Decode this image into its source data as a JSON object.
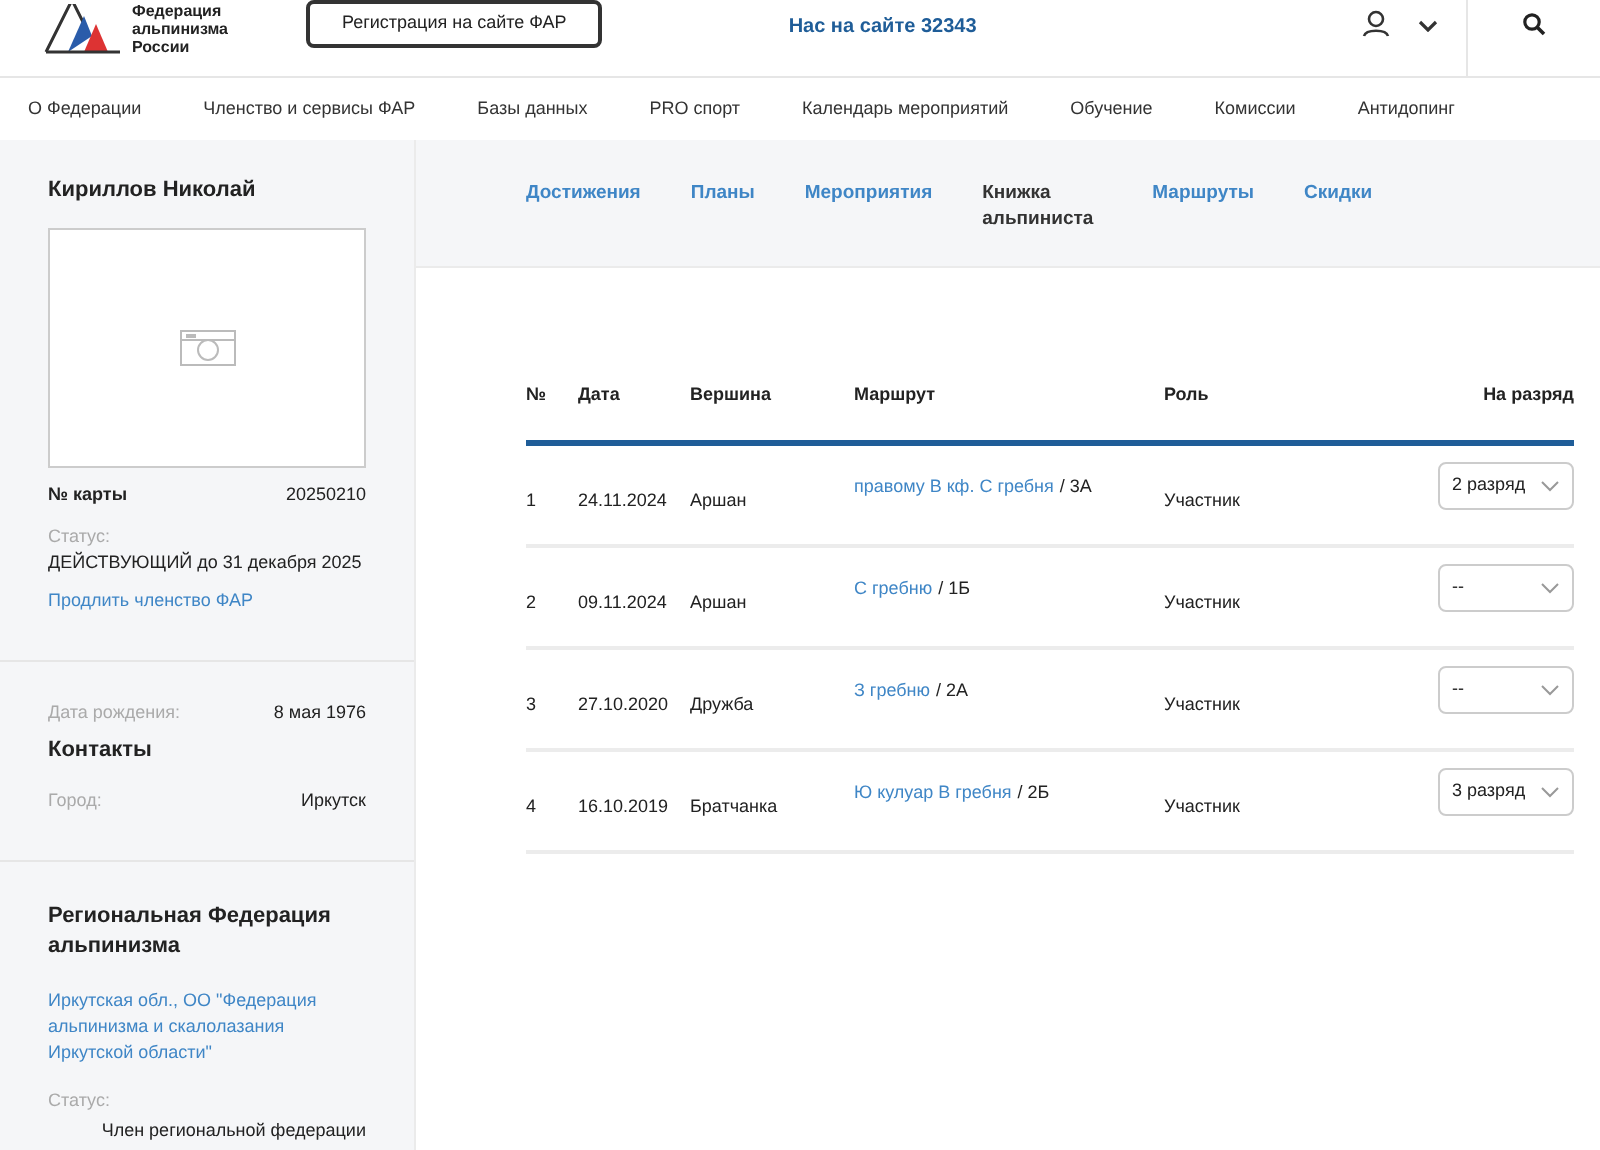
{
  "header": {
    "logo_text": "Федерация альпинизма России",
    "register_button": "Регистрация на сайте ФАР",
    "online": "Нас на сайте 32343"
  },
  "nav": [
    "О Федерации",
    "Членство и сервисы ФАР",
    "Базы данных",
    "PRO спорт",
    "Календарь мероприятий",
    "Обучение",
    "Комиссии",
    "Антидопинг"
  ],
  "profile": {
    "name": "Кириллов Николай",
    "card_label": "№ карты",
    "card_number": "20250210",
    "status_label": "Статус:",
    "status": "ДЕЙСТВУЮЩИЙ до 31 декабря 2025",
    "renew_link": "Продлить членство ФАР",
    "birth_label": "Дата рождения:",
    "birth": "8 мая 1976",
    "contacts_title": "Контакты",
    "city_label": "Город:",
    "city": "Иркутск",
    "region_title": "Региональная Федерация альпинизма",
    "region_link": "Иркутская обл., ОО \"Федерация альпинизма и скалолазания Иркутской области\"",
    "region_status_label": "Статус:",
    "region_status": "Член региональной федерации"
  },
  "tabs": [
    {
      "label": "Достижения",
      "selected": false
    },
    {
      "label": "Планы",
      "selected": false
    },
    {
      "label": "Мероприятия",
      "selected": false
    },
    {
      "label": "Книжка альпиниста",
      "selected": true
    },
    {
      "label": "Маршруты",
      "selected": false
    },
    {
      "label": "Скидки",
      "selected": false
    }
  ],
  "table": {
    "columns": [
      "№",
      "Дата",
      "Вершина",
      "Маршрут",
      "Роль",
      "На разряд"
    ],
    "rows": [
      {
        "n": "1",
        "date": "24.11.2024",
        "peak": "Аршан",
        "route": "правому В кф. С гребня",
        "grade": "/ 3А",
        "role": "Участник",
        "rank": "2 разряд"
      },
      {
        "n": "2",
        "date": "09.11.2024",
        "peak": "Аршан",
        "route": "С гребню",
        "grade": "/ 1Б",
        "role": "Участник",
        "rank": "--"
      },
      {
        "n": "3",
        "date": "27.10.2020",
        "peak": "Дружба",
        "route": "З гребню",
        "grade": "/ 2А",
        "role": "Участник",
        "rank": "--"
      },
      {
        "n": "4",
        "date": "16.10.2019",
        "peak": "Братчанка",
        "route": "Ю кулуар В гребня",
        "grade": "/ 2Б",
        "role": "Участник",
        "rank": "3 разряд"
      }
    ]
  }
}
